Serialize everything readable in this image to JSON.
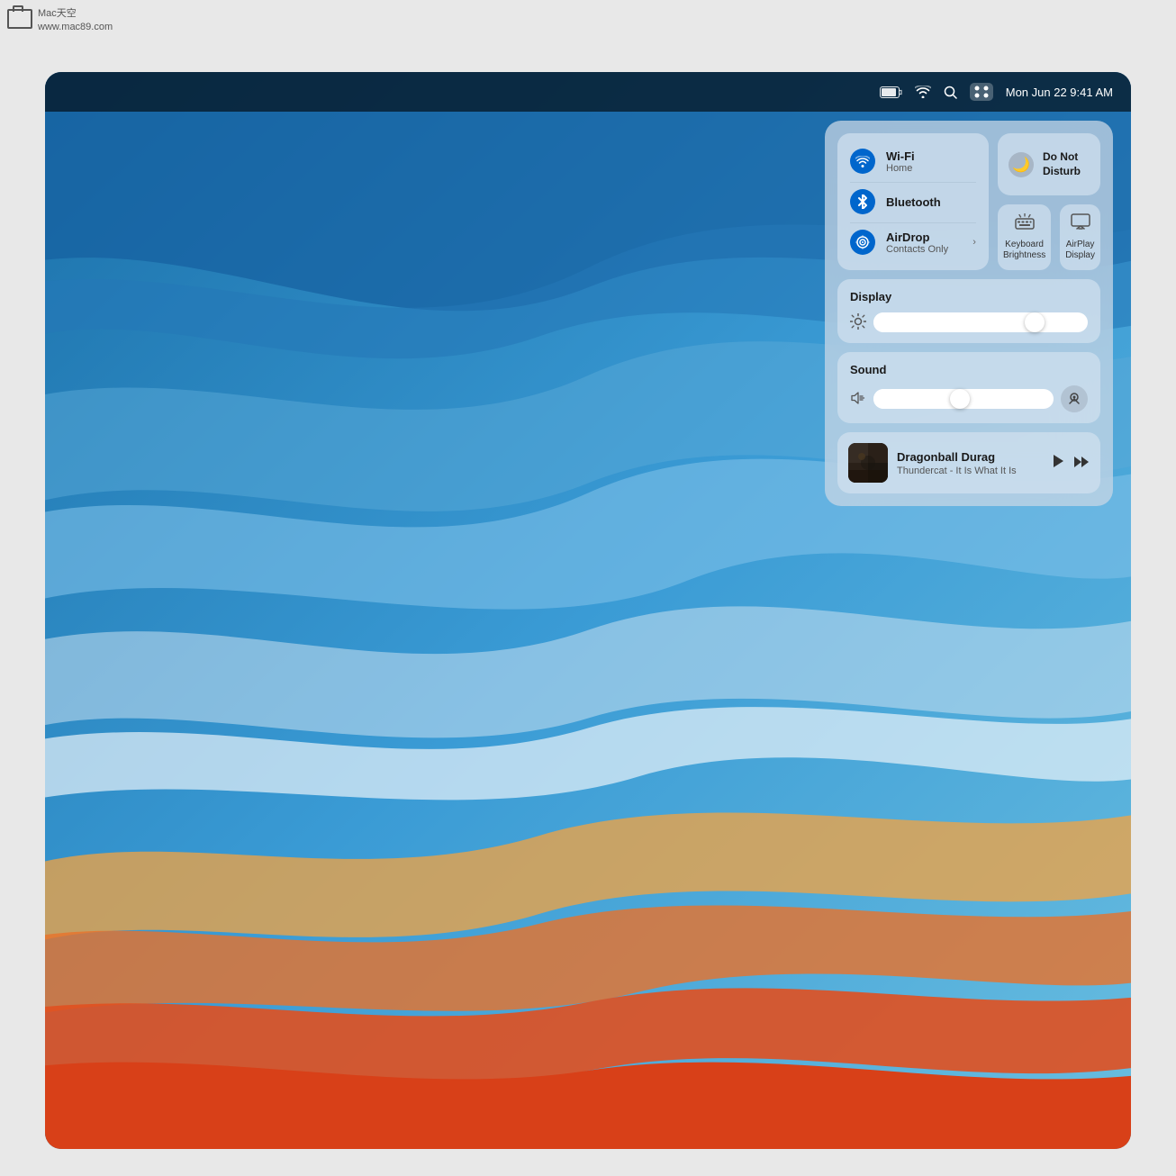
{
  "watermark": {
    "line1": "Mac天空",
    "line2": "www.mac89.com"
  },
  "menubar": {
    "datetime": "Mon Jun 22   9:41 AM",
    "battery_icon": "🔋",
    "wifi_icon": "wifi",
    "search_icon": "search",
    "control_center_icon": "control"
  },
  "control_center": {
    "wifi": {
      "label": "Wi-Fi",
      "subtitle": "Home",
      "enabled": true
    },
    "bluetooth": {
      "label": "Bluetooth",
      "enabled": true
    },
    "airdrop": {
      "label": "AirDrop",
      "subtitle": "Contacts Only",
      "has_chevron": true
    },
    "do_not_disturb": {
      "label": "Do Not Disturb",
      "enabled": false
    },
    "keyboard_brightness": {
      "label": "Keyboard Brightness"
    },
    "airplay_display": {
      "label": "AirPlay Display"
    },
    "display": {
      "section_title": "Display",
      "brightness_percent": 75
    },
    "sound": {
      "section_title": "Sound",
      "volume_percent": 48
    },
    "now_playing": {
      "track_title": "Dragonball Durag",
      "track_subtitle": "Thundercat - It Is What It Is"
    }
  }
}
